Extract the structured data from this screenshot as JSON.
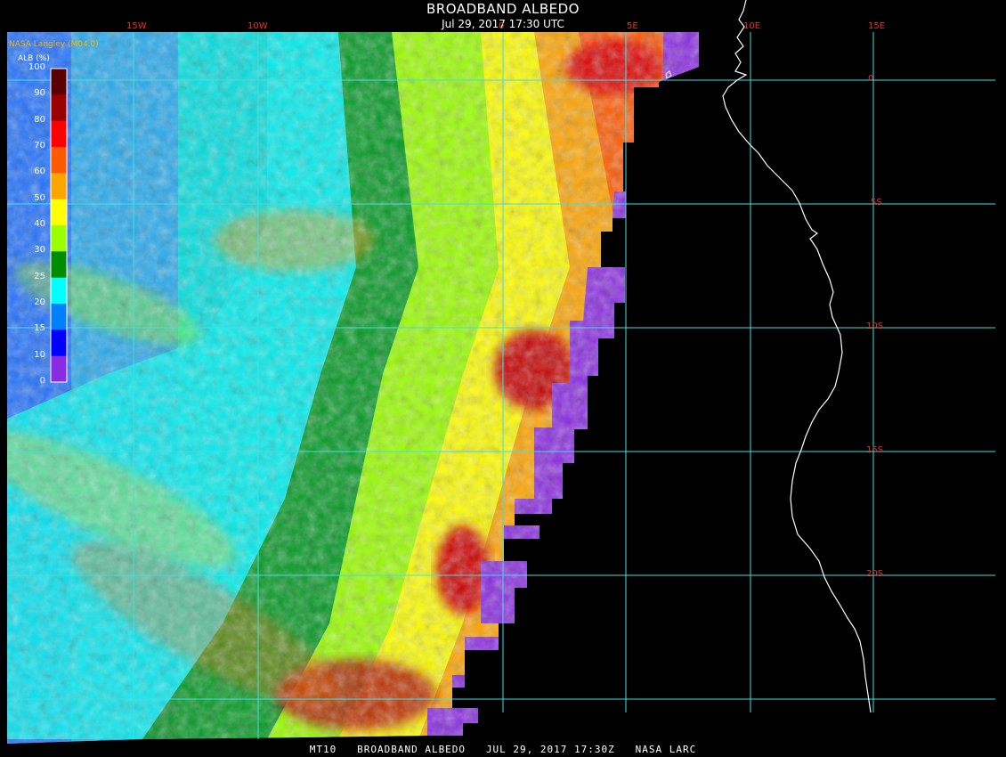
{
  "header": {
    "title": "BROADBAND ALBEDO",
    "datetime": "Jul 29, 2017 17:30 UTC",
    "org": "NASA Langley (M04.0)"
  },
  "footer": {
    "product": "MT10",
    "name": "BROADBAND ALBEDO",
    "datetime": "JUL 29, 2017 17:30Z",
    "source": "NASA LARC"
  },
  "legend": {
    "title": "ALB (%)",
    "ticks": [
      "100",
      "90",
      "80",
      "70",
      "60",
      "50",
      "40",
      "30",
      "25",
      "20",
      "15",
      "10",
      "0"
    ],
    "colors": [
      "#5a0000",
      "#9a0000",
      "#ff0000",
      "#ff5a00",
      "#ffa500",
      "#ffff00",
      "#9bff00",
      "#008c00",
      "#00ffff",
      "#0080ff",
      "#0000ff",
      "#8a2be2"
    ]
  },
  "grid": {
    "lon_labels": [
      "15W",
      "10W",
      "0",
      "5E",
      "10E",
      "15E"
    ],
    "lat_labels": [
      "0",
      "5S",
      "10S",
      "15S",
      "20S"
    ],
    "grid_color": "#40e0e0",
    "label_color": "#e83030",
    "coast_color": "#ffffff",
    "no_data_color": "#000000"
  }
}
